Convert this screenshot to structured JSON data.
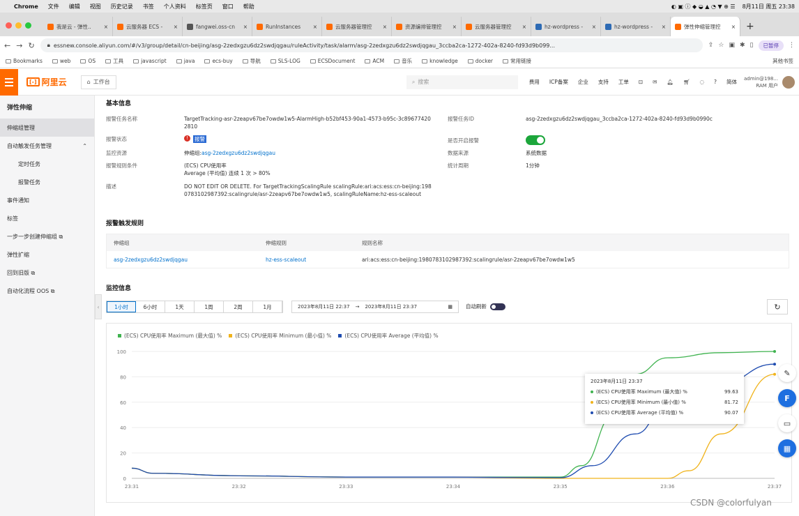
{
  "mac": {
    "app": "Chrome",
    "menus": [
      "文件",
      "编辑",
      "视图",
      "历史记录",
      "书签",
      "个人资料",
      "标签页",
      "窗口",
      "帮助"
    ],
    "clock": "8月11日 周五 23:38"
  },
  "tabs": [
    {
      "label": "我是云 - 弹性..",
      "color": "#ff6a00"
    },
    {
      "label": "云服务器 ECS -",
      "color": "#ff6a00"
    },
    {
      "label": "fangwei.oss-cn",
      "color": "#555"
    },
    {
      "label": "RunInstances",
      "color": "#ff6a00"
    },
    {
      "label": "云服务器管理控",
      "color": "#ff6a00"
    },
    {
      "label": "资源编排管理控",
      "color": "#ff6a00"
    },
    {
      "label": "云服务器管理控",
      "color": "#ff6a00"
    },
    {
      "label": "hz-wordpress -",
      "color": "#2d6ab4"
    },
    {
      "label": "hz-wordpress -",
      "color": "#2d6ab4"
    },
    {
      "label": "弹性伸缩管理控",
      "color": "#ff6a00",
      "active": true
    }
  ],
  "address": {
    "url": "essnew.console.aliyun.com/#/v3/group/detail/cn-beijing/asg-2zedxgzu6dz2swdjqgau/ruleActivity/task/alarm/asg-2zedxgzu6dz2swdjqgau_3ccba2ca-1272-402a-8240-fd93d9b099...",
    "profile": "已暂停"
  },
  "bookmarks": [
    "Bookmarks",
    "web",
    "OS",
    "工具",
    "javascript",
    "java",
    "ecs-buy",
    "导航",
    "SLS-LOG",
    "ECSDocument",
    "ACM",
    "音乐",
    "knowledge",
    "docker",
    "常用链接"
  ],
  "bookmarks_other": "其他书签",
  "console": {
    "logo": "阿里云",
    "workbench": "工作台",
    "search_placeholder": "搜索",
    "nav": [
      "费用",
      "ICP备案",
      "企业",
      "支持",
      "工单"
    ],
    "user": "admin@198...",
    "user_sub": "RAM 用户",
    "lang": "简体"
  },
  "sidebar": {
    "title": "弹性伸缩",
    "items": [
      {
        "label": "伸缩组管理",
        "selected": true
      },
      {
        "label": "自动触发任务管理",
        "expandable": true
      },
      {
        "label": "定时任务",
        "sub": true
      },
      {
        "label": "报警任务",
        "sub": true
      },
      {
        "label": "事件通知"
      },
      {
        "label": "标签"
      },
      {
        "label": "一步一步创建伸缩组 ⧉"
      },
      {
        "label": "弹性扩缩"
      },
      {
        "label": "回到旧版 ⧉"
      },
      {
        "label": "自动化流程 OOS ⧉"
      }
    ]
  },
  "basic": {
    "title": "基本信息",
    "task_name_label": "报警任务名称",
    "task_name": "TargetTracking-asr-2zeapv67be7owdw1w5-AlarmHigh-b52bf453-90a1-4573-b95c-3c89677420",
    "task_name_cont": "2810",
    "alarm_id_label": "报警任务ID",
    "alarm_id": "asg-2zedxgzu6dz2swdjqgau_3ccba2ca-1272-402a-8240-fd93d9b0990c",
    "status_label": "报警状态",
    "status": "报警",
    "enabled_label": "是否开启报警",
    "monitor_label": "监控资源",
    "monitor_prefix": "伸缩组: ",
    "monitor_link": "asg-2zedxgzu6dz2swdjqgau",
    "data_source_label": "数据来源",
    "data_source": "系统数据",
    "condition_label": "报警规则条件",
    "condition_1": "(ECS) CPU使用率",
    "condition_2": "Average (平均值) 连续 1 次 > 80%",
    "period_label": "统计周期",
    "period": "1分钟",
    "desc_label": "描述",
    "desc_1": "DO NOT EDIT OR DELETE. For TargetTrackingScalingRule scalingRule:ari:acs:ess:cn-beijing:198",
    "desc_2": "0783102987392:scalingrule/asr-2zeapv67be7owdw1w5, scalingRuleName:hz-ess-scaleout"
  },
  "rules": {
    "title": "报警触发规则",
    "headers": [
      "伸缩组",
      "伸缩规则",
      "规则名称"
    ],
    "row": [
      "asg-2zedxgzu6dz2swdjqgau",
      "hz-ess-scaleout",
      "ari:acs:ess:cn-beijing:1980783102987392:scalingrule/asr-2zeapv67be7owdw1w5"
    ]
  },
  "monitor": {
    "title": "监控信息",
    "ranges": [
      "1小时",
      "6小时",
      "1天",
      "1周",
      "2周",
      "1月"
    ],
    "selected_range": 0,
    "date_start": "2023年8月11日 22:37",
    "date_arrow": "→",
    "date_end": "2023年8月11日 23:37",
    "auto_refresh": "自动刷新"
  },
  "chart_data": {
    "type": "line",
    "x": [
      "23:31",
      "23:32",
      "23:33",
      "23:34",
      "23:35",
      "23:36",
      "23:37"
    ],
    "ylim": [
      0,
      100
    ],
    "yticks": [
      0,
      20,
      40,
      60,
      80,
      100
    ],
    "grid": true,
    "legend_placement": "top-left",
    "series": [
      {
        "name": "(ECS) CPU使用率 Maximum (最大值) %",
        "color": "#3fb34f",
        "points": [
          [
            23.31,
            8
          ],
          [
            23.312,
            4
          ],
          [
            23.32,
            2
          ],
          [
            23.33,
            1
          ],
          [
            23.34,
            1
          ],
          [
            23.35,
            1
          ],
          [
            23.352,
            10
          ],
          [
            23.355,
            50
          ],
          [
            23.357,
            82
          ],
          [
            23.36,
            95
          ],
          [
            23.365,
            99
          ],
          [
            23.37,
            100
          ]
        ]
      },
      {
        "name": "(ECS) CPU使用率 Minimum (最小值) %",
        "color": "#f0b31b",
        "points": [
          [
            23.31,
            8
          ],
          [
            23.312,
            4
          ],
          [
            23.32,
            2
          ],
          [
            23.33,
            1
          ],
          [
            23.34,
            1
          ],
          [
            23.35,
            0
          ],
          [
            23.36,
            0
          ],
          [
            23.362,
            6
          ],
          [
            23.365,
            35
          ],
          [
            23.37,
            82
          ]
        ]
      },
      {
        "name": "(ECS) CPU使用率 Average (平均值) %",
        "color": "#1f4cb0",
        "points": [
          [
            23.31,
            8
          ],
          [
            23.312,
            4
          ],
          [
            23.32,
            2
          ],
          [
            23.33,
            1
          ],
          [
            23.34,
            1
          ],
          [
            23.35,
            0.5
          ],
          [
            23.353,
            10
          ],
          [
            23.357,
            35
          ],
          [
            23.36,
            58
          ],
          [
            23.365,
            75
          ],
          [
            23.37,
            90
          ]
        ]
      }
    ]
  },
  "tooltip": {
    "time": "2023年8月11日 23:37",
    "rows": [
      {
        "label": "(ECS) CPU使用率 Maximum (最大值) %",
        "value": "99.63",
        "color": "#3fb34f"
      },
      {
        "label": "(ECS) CPU使用率 Minimum (最小值) %",
        "value": "81.72",
        "color": "#f0b31b"
      },
      {
        "label": "(ECS) CPU使用率 Average (平均值) %",
        "value": "90.07",
        "color": "#1f4cb0"
      }
    ]
  },
  "watermark": "CSDN @colorfulyan"
}
